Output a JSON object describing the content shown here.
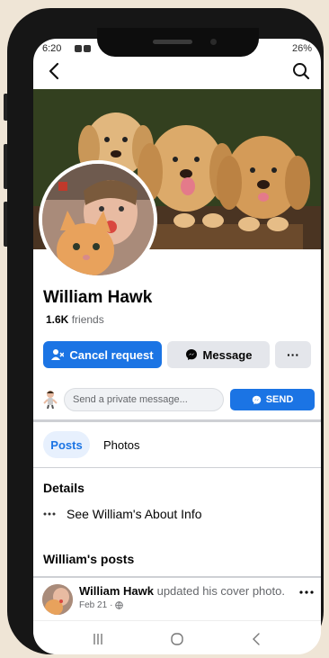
{
  "status_bar": {
    "time": "6:20",
    "battery": "26%"
  },
  "profile": {
    "name": "William Hawk",
    "friends_count": "1.6K",
    "friends_label": "friends"
  },
  "actions": {
    "cancel_label": "Cancel request",
    "message_label": "Message",
    "more_label": "···"
  },
  "private_message": {
    "placeholder": "Send a private message...",
    "send_label": "SEND"
  },
  "tabs": [
    {
      "label": "Posts",
      "selected": true
    },
    {
      "label": "Photos",
      "selected": false
    }
  ],
  "details": {
    "title": "Details",
    "about_label": "See William's About Info"
  },
  "posts_section": {
    "title": "William's posts"
  },
  "post": {
    "author": "William Hawk",
    "action": "updated his cover photo.",
    "date": "Feb 21",
    "privacy_separator": "·"
  },
  "colors": {
    "accent": "#1b74e4",
    "button_gray": "#e4e6eb",
    "text_secondary": "#65676b"
  },
  "icons": [
    "back-arrow-icon",
    "search-icon",
    "add-friend-icon",
    "messenger-icon",
    "globe-icon",
    "recent-apps-icon",
    "home-icon",
    "back-nav-icon"
  ]
}
